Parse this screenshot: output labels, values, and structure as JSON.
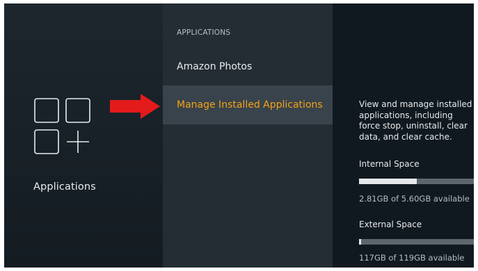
{
  "left": {
    "icon": "applications-grid-plus-icon",
    "label": "Applications"
  },
  "arrow": {
    "icon": "right-arrow-icon",
    "color": "#e31b1b"
  },
  "menu": {
    "section_title": "APPLICATIONS",
    "items": [
      {
        "label": "Amazon Photos",
        "selected": false
      },
      {
        "label": "Manage Installed Applications",
        "selected": true
      }
    ]
  },
  "detail": {
    "description": "View and manage installed applications, including force stop, uninstall, clear data, and clear cache.",
    "internal": {
      "label": "Internal Space",
      "available_text": "2.81GB of 5.60GB available",
      "used_fraction": 0.5
    },
    "external": {
      "label": "External Space",
      "available_text": "117GB of 119GB available",
      "used_fraction": 0.017
    }
  },
  "colors": {
    "accent": "#f4a317",
    "background": "#121a20"
  }
}
